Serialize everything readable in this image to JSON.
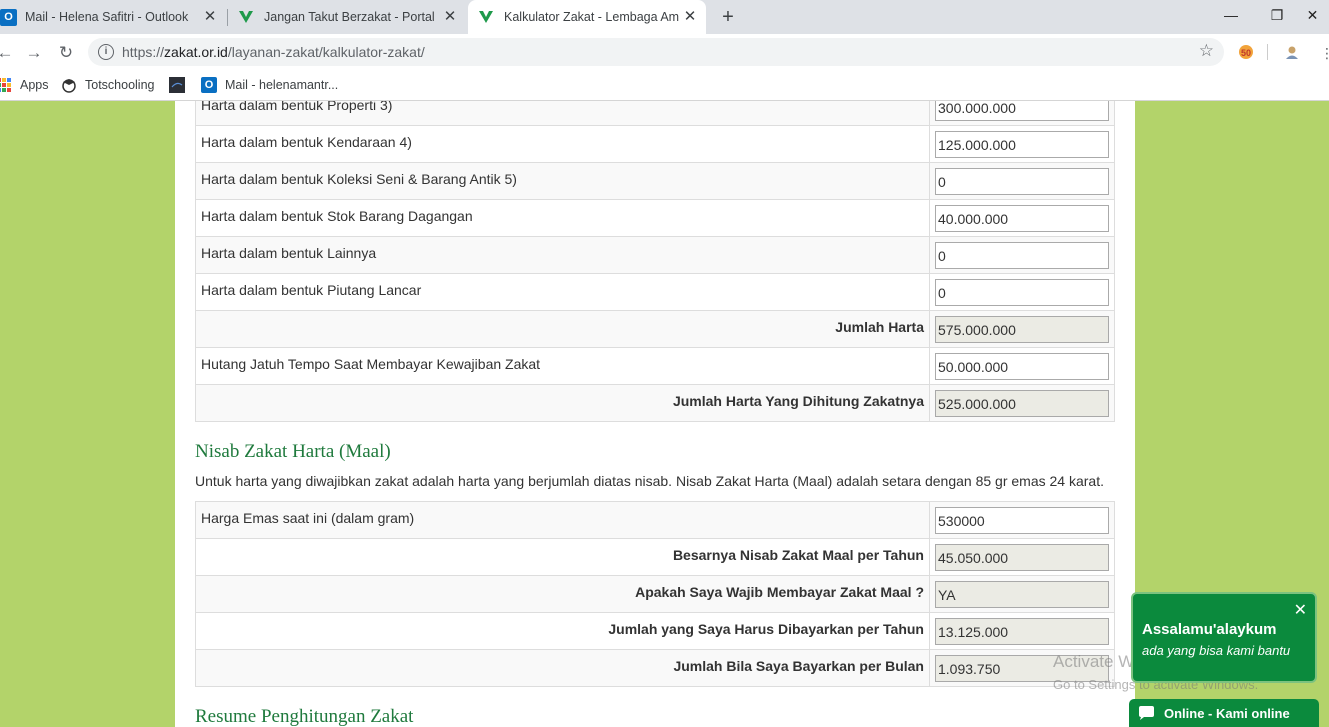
{
  "browser": {
    "tabs": [
      {
        "title": "Mail - Helena Safitri - Outlook",
        "favicon": "outlook-icon"
      },
      {
        "title": "Jangan Takut Berzakat - Portal Do",
        "favicon": "baznas-icon"
      },
      {
        "title": "Kalkulator Zakat - Lembaga Amil",
        "favicon": "baznas-icon"
      }
    ],
    "close_glyph": "✕",
    "new_tab_glyph": "+",
    "url": {
      "scheme": "https://",
      "host": "zakat.or.id",
      "path": "/layanan-zakat/kalkulator-zakat/"
    },
    "window_controls": {
      "minimize": "—",
      "maximize": "❐",
      "close": "✕"
    },
    "bookmarks": [
      {
        "label": "Apps",
        "icon": "apps-grid-icon"
      },
      {
        "label": "Totschooling",
        "icon": "totschooling-icon"
      },
      {
        "label": "",
        "icon": "bookmark-dark-icon"
      },
      {
        "label": "Mail - helenamantr...",
        "icon": "outlook-icon"
      }
    ]
  },
  "harta_table": {
    "rows": [
      {
        "label": "Harta dalam bentuk Properti 3)",
        "value": "300.000.000",
        "readonly": false
      },
      {
        "label": "Harta dalam bentuk Kendaraan 4)",
        "value": "125.000.000",
        "readonly": false
      },
      {
        "label": "Harta dalam bentuk Koleksi Seni & Barang Antik 5)",
        "value": "0",
        "readonly": false
      },
      {
        "label": "Harta dalam bentuk Stok Barang Dagangan",
        "value": "40.000.000",
        "readonly": false
      },
      {
        "label": "Harta dalam bentuk Lainnya",
        "value": "0",
        "readonly": false
      },
      {
        "label": "Harta dalam bentuk Piutang Lancar",
        "value": "0",
        "readonly": false
      },
      {
        "label": "Jumlah Harta",
        "value": "575.000.000",
        "readonly": true
      },
      {
        "label": "Hutang Jatuh Tempo Saat Membayar Kewajiban Zakat",
        "value": "50.000.000",
        "readonly": false
      },
      {
        "label": "Jumlah Harta Yang Dihitung Zakatnya",
        "value": "525.000.000",
        "readonly": true
      }
    ]
  },
  "nisab_section": {
    "title": "Nisab Zakat Harta (Maal)",
    "description": "Untuk harta yang diwajibkan zakat adalah harta yang berjumlah diatas nisab. Nisab Zakat Harta (Maal) adalah setara dengan 85 gr emas 24 karat."
  },
  "nisab_table": {
    "rows": [
      {
        "label": "Harga Emas saat ini (dalam gram)",
        "value": "530000",
        "readonly": false
      },
      {
        "label": "Besarnya Nisab Zakat Maal per Tahun",
        "value": "45.050.000",
        "readonly": true
      },
      {
        "label": "Apakah Saya Wajib Membayar Zakat Maal ?",
        "value": "YA",
        "readonly": true
      },
      {
        "label": "Jumlah yang Saya Harus Dibayarkan per Tahun",
        "value": "13.125.000",
        "readonly": true
      },
      {
        "label": "Jumlah Bila Saya Bayarkan per Bulan",
        "value": "1.093.750",
        "readonly": true
      }
    ]
  },
  "resume_section": {
    "title": "Resume Penghitungan Zakat"
  },
  "chat": {
    "greeting": "Assalamu'alaykum",
    "subtitle": "ada yang bisa kami bantu",
    "close_glyph": "✕",
    "online_label": "Online - Kami online"
  },
  "watermark": {
    "line1": "Activate Windows",
    "line2": "Go to Settings to activate Windows."
  },
  "colors": {
    "page_bg": "#b3d36a",
    "section_title": "#1f7a3d",
    "chat_green": "#0b8a3d",
    "readonly_field": "#ebebe4"
  }
}
